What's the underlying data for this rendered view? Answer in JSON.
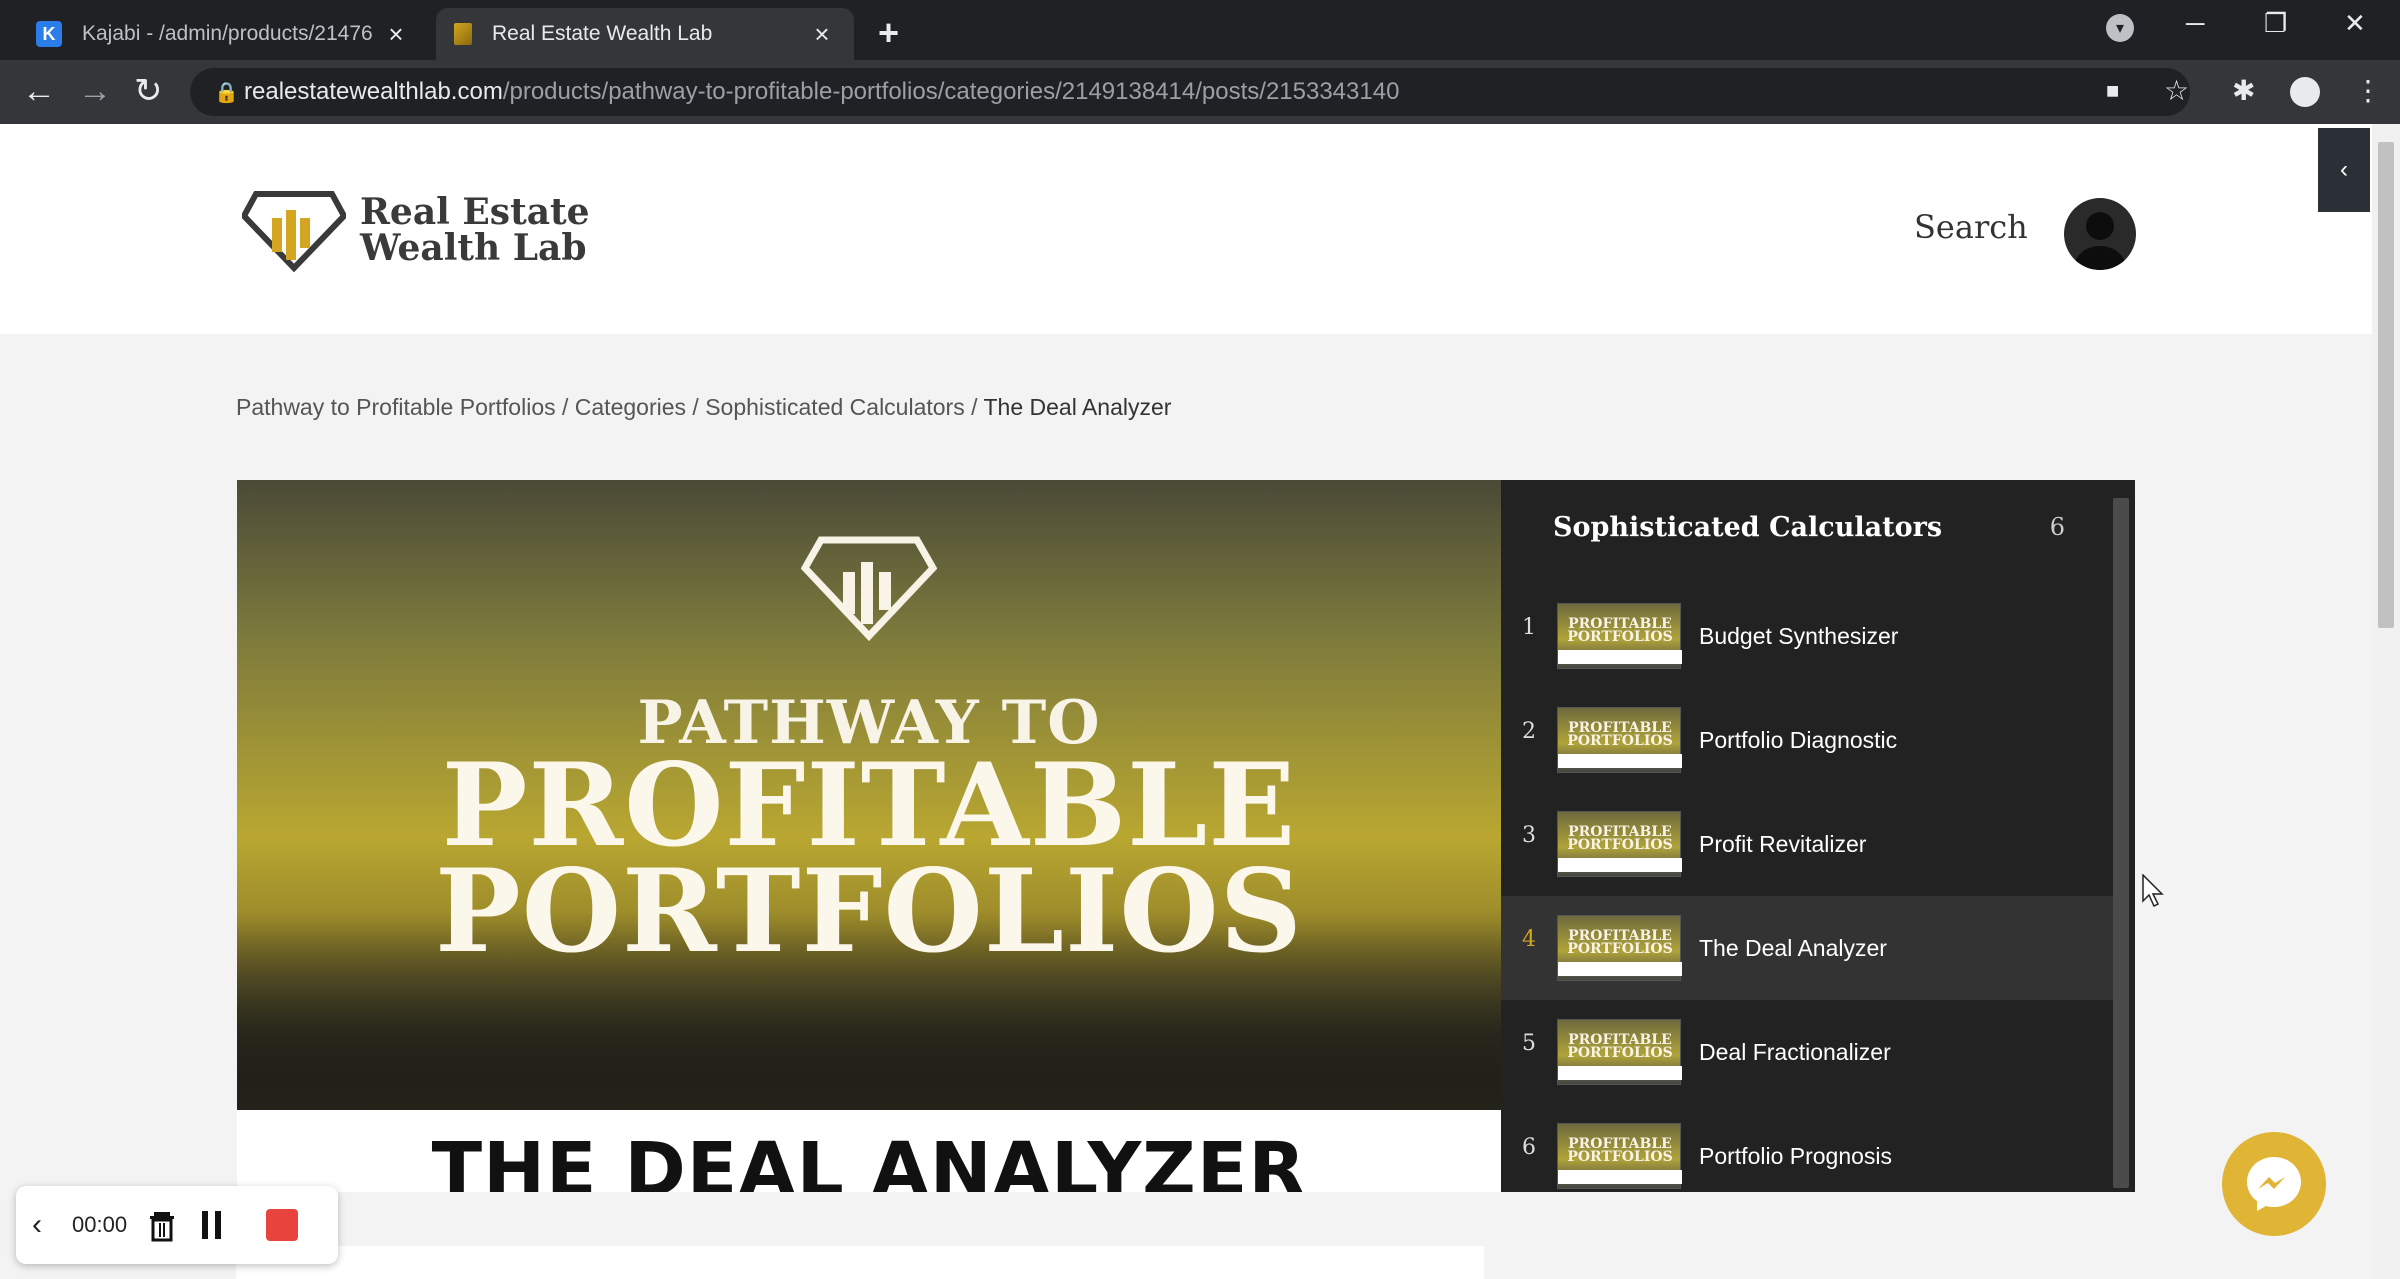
{
  "browser": {
    "tabs": [
      {
        "title": "Kajabi - /admin/products/21476",
        "active": false
      },
      {
        "title": "Real Estate Wealth Lab",
        "active": true
      }
    ],
    "url_host": "realestatewealthlab.com",
    "url_path": "/products/pathway-to-profitable-portfolios/categories/2149138414/posts/2153343140"
  },
  "site": {
    "logo_line1": "Real Estate",
    "logo_line2": "Wealth Lab",
    "search_label": "Search"
  },
  "breadcrumb": {
    "items": [
      "Pathway to Profitable Portfolios",
      "Categories",
      "Sophisticated Calculators"
    ],
    "separator": " / ",
    "current": "The Deal Analyzer"
  },
  "hero": {
    "subtitle": "PATHWAY TO",
    "title_line1": "PROFITABLE",
    "title_line2": "PORTFOLIOS",
    "band": "THE DEAL ANALYZER"
  },
  "playlist": {
    "title": "Sophisticated Calculators",
    "count": "6",
    "items": [
      {
        "num": "1",
        "label": "Budget Synthesizer",
        "active": false
      },
      {
        "num": "2",
        "label": "Portfolio Diagnostic",
        "active": false
      },
      {
        "num": "3",
        "label": "Profit Revitalizer",
        "active": false
      },
      {
        "num": "4",
        "label": "The Deal Analyzer",
        "active": true
      },
      {
        "num": "5",
        "label": "Deal Fractionalizer",
        "active": false
      },
      {
        "num": "6",
        "label": "Portfolio Prognosis",
        "active": false
      }
    ],
    "thumb_title": "PROFITABLE PORTFOLIOS"
  },
  "recorder": {
    "time": "00:00"
  },
  "colors": {
    "accent_gold": "#d4a521",
    "messenger_bg": "#e0b535",
    "record_red": "#e8433d"
  }
}
